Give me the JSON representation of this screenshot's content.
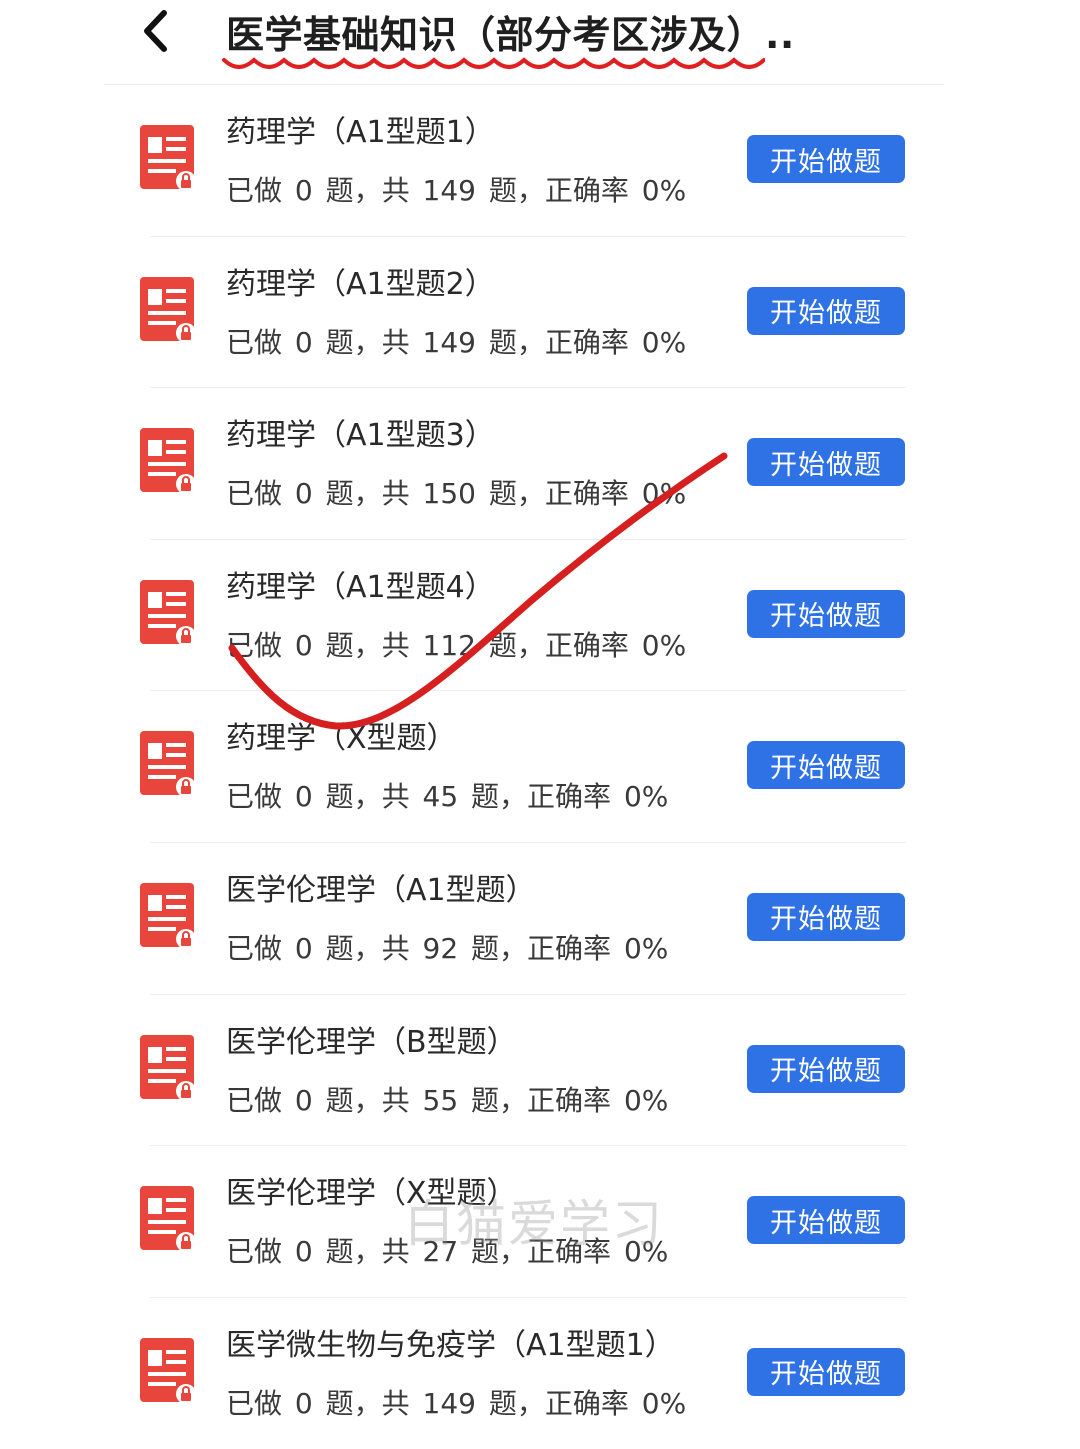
{
  "header": {
    "title": "医学基础知识（部分考区涉及）..",
    "back_icon": "chevron-left-icon",
    "underline_color": "#e02020"
  },
  "colors": {
    "accent": "#2f72e6",
    "icon_red": "#e8453c",
    "annotation_red": "#d61f1f"
  },
  "items": [
    {
      "title": "药理学（A1型题1）",
      "stats": "已做 0 题，共 149 题，正确率 0%",
      "button": "开始做题"
    },
    {
      "title": "药理学（A1型题2）",
      "stats": "已做 0 题，共 149 题，正确率 0%",
      "button": "开始做题"
    },
    {
      "title": "药理学（A1型题3）",
      "stats": "已做 0 题，共 150 题，正确率 0%",
      "button": "开始做题"
    },
    {
      "title": "药理学（A1型题4）",
      "stats": "已做 0 题，共 112 题，正确率 0%",
      "button": "开始做题"
    },
    {
      "title": "药理学（X型题）",
      "stats": "已做 0 题，共 45 题，正确率 0%",
      "button": "开始做题"
    },
    {
      "title": "医学伦理学（A1型题）",
      "stats": "已做 0 题，共 92 题，正确率 0%",
      "button": "开始做题"
    },
    {
      "title": "医学伦理学（B型题）",
      "stats": "已做 0 题，共 55 题，正确率 0%",
      "button": "开始做题"
    },
    {
      "title": "医学伦理学（X型题）",
      "stats": "已做 0 题，共 27 题，正确率 0%",
      "button": "开始做题"
    },
    {
      "title": "医学微生物与免疫学（A1型题1）",
      "stats": "已做 0 题，共 149 题，正确率 0%",
      "button": "开始做题"
    }
  ],
  "watermark": "白猫爱学习"
}
